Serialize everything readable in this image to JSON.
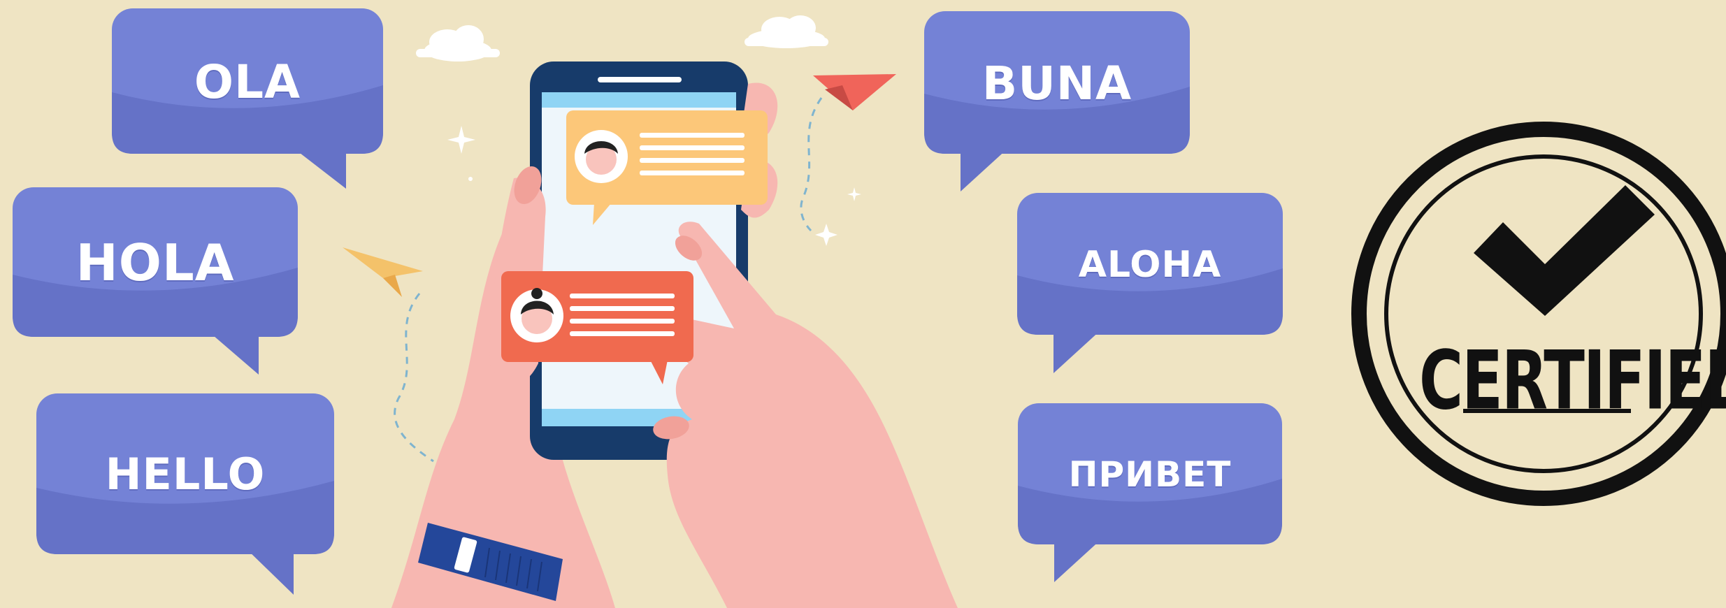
{
  "greetings": {
    "ola": "OLA",
    "hola": "HOLA",
    "hello": "HELLO",
    "buna": "BUNA",
    "aloha": "ALOHA",
    "privet": "ПРИВЕТ"
  },
  "stamp": {
    "label": "CERTIFIED"
  },
  "colors": {
    "background": "#efe4c3",
    "bubble": "#7482d6",
    "bubble_shade": "#6572c7",
    "phone_frame": "#173b6a",
    "phone_screen": "#eef6fb",
    "chat_top": "#fcc779",
    "chat_bottom": "#f06a4f",
    "skin": "#f7b7b1",
    "watch_strap": "#24479a",
    "stamp": "#111111"
  },
  "icons": [
    "cloud-icon",
    "paper-plane-icon",
    "sparkle-icon",
    "checkmark-icon",
    "avatar-icon"
  ]
}
